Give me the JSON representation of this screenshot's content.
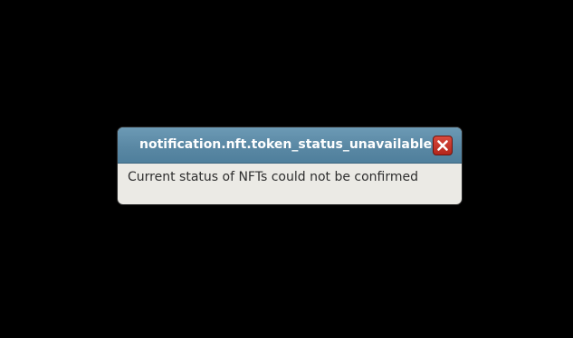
{
  "notification": {
    "title": "notification.nft.token_status_unavailable.title",
    "message": "Current status of NFTs could not be confirmed",
    "close_icon": "close-icon"
  },
  "colors": {
    "background": "#000000",
    "titlebar": "#5a88a4",
    "body": "#ebeae5",
    "close_button": "#c2332a"
  }
}
